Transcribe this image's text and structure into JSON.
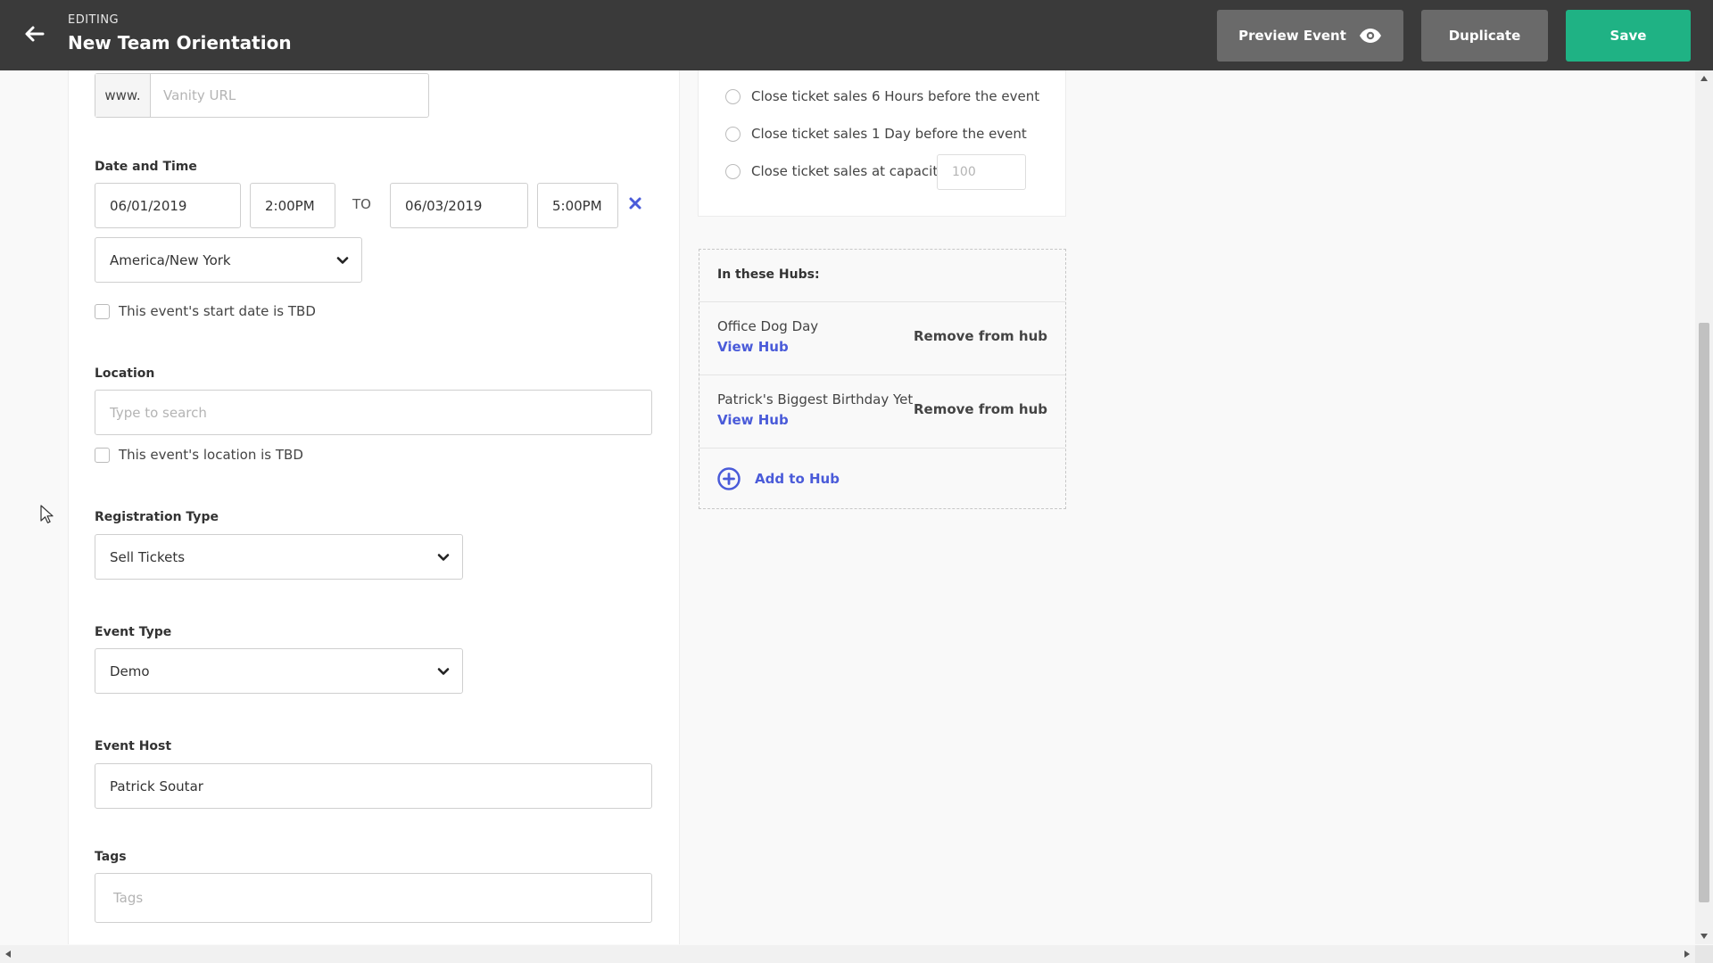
{
  "header": {
    "editing_label": "EDITING",
    "title": "New Team Orientation",
    "back_icon": "arrow-left-icon",
    "preview_label": "Preview Event",
    "preview_icon": "eye-icon",
    "duplicate_label": "Duplicate",
    "save_label": "Save",
    "colors": {
      "bar": "#3a3a3a",
      "secondary_button": "#6a6a6a",
      "save_button": "#1fb284"
    }
  },
  "vanity": {
    "prefix": "www.",
    "placeholder": "Vanity URL"
  },
  "date_time": {
    "label": "Date and Time",
    "start_date": "06/01/2019",
    "start_time": "2:00PM",
    "to_label": "TO",
    "end_date": "06/03/2019",
    "end_time": "5:00PM",
    "clear_icon": "close-x-icon",
    "timezone": "America/New York",
    "tbd_checkbox_label": "This event's start date is TBD"
  },
  "location": {
    "label": "Location",
    "placeholder": "Type to search",
    "tbd_checkbox_label": "This event's location is TBD"
  },
  "registration": {
    "label": "Registration Type",
    "value": "Sell Tickets"
  },
  "event_type": {
    "label": "Event Type",
    "value": "Demo"
  },
  "event_host": {
    "label": "Event Host",
    "value": "Patrick Soutar"
  },
  "tags": {
    "label": "Tags",
    "placeholder": "Tags"
  },
  "ticket_close": {
    "options": [
      "Close ticket sales 6 Hours before the event",
      "Close ticket sales 1 Day before the event",
      "Close ticket sales at capacity"
    ],
    "capacity_placeholder": "100"
  },
  "hubs": {
    "title": "In these Hubs:",
    "items": [
      {
        "name": "Office Dog Day",
        "view_label": "View Hub",
        "remove_label": "Remove from hub"
      },
      {
        "name": "Patrick's Biggest Birthday Yet",
        "view_label": "View Hub",
        "remove_label": "Remove from hub"
      }
    ],
    "add_label": "Add to Hub",
    "add_icon": "plus-circle-icon",
    "link_color": "#4a5bd9"
  }
}
